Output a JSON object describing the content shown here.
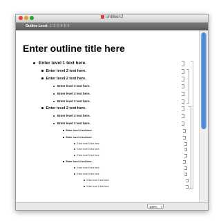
{
  "window": {
    "title": "Untitled-2"
  },
  "toolbar": {
    "outline_level_label": "Outline Level:",
    "levels": [
      "1",
      "2",
      "3",
      "4",
      "5",
      "6"
    ]
  },
  "document": {
    "title": "Enter outline title here",
    "rows": [
      {
        "level": 1,
        "text": "Enter level 1 text here."
      },
      {
        "level": 2,
        "text": "Enter level 2 text here."
      },
      {
        "level": 2,
        "text": "Enter level 2 text here."
      },
      {
        "level": 3,
        "text": "Enter level 3 text here."
      },
      {
        "level": 3,
        "text": "Enter level 3 text here."
      },
      {
        "level": 3,
        "text": "Enter level 3 text here."
      },
      {
        "level": 2,
        "text": "Enter level 2 text here."
      },
      {
        "level": 3,
        "text": "Enter level 3 text here."
      },
      {
        "level": 3,
        "text": "Enter level 3 text here."
      },
      {
        "level": 4,
        "text": "Enter level 4 text here."
      },
      {
        "level": 4,
        "text": "Enter level 4 text here."
      },
      {
        "level": 5,
        "text": "Enter level 5 text here."
      },
      {
        "level": 5,
        "text": "Enter level 5 text here."
      },
      {
        "level": 5,
        "text": "Enter level 5 text here."
      },
      {
        "level": 4,
        "text": "Enter level 4 text here."
      },
      {
        "level": 5,
        "text": "Enter level 5 text here."
      },
      {
        "level": 5,
        "text": "Enter level 5 text here."
      },
      {
        "level": 6,
        "text": "Enter level 6 text here."
      },
      {
        "level": 6,
        "text": "Enter level 6 text here."
      }
    ]
  },
  "statusbar": {
    "zoom": "100%"
  },
  "colors": {
    "scroll_thumb": "#3f7ad0",
    "toolbar": "#6a6a6a"
  }
}
